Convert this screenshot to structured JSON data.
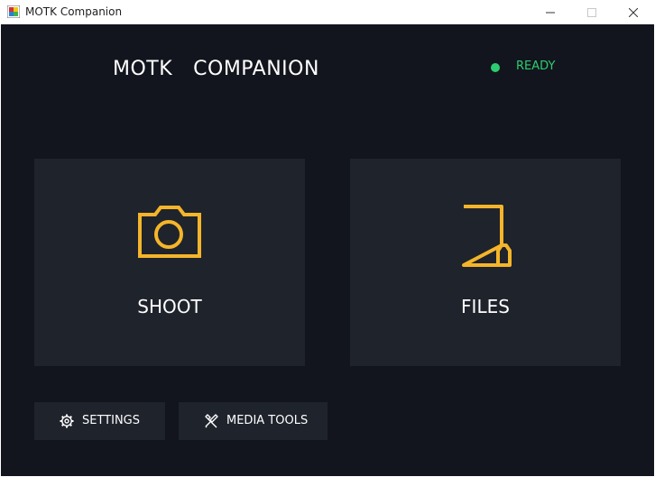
{
  "window": {
    "title": "MOTK Companion"
  },
  "header": {
    "app_title": "MOTK  COMPANION",
    "status_text": "READY",
    "status_color": "#2ecc71"
  },
  "cards": {
    "shoot_label": "SHOOT",
    "shoot_icon": "camera-icon",
    "files_label": "FILES",
    "files_icon": "file-icon"
  },
  "buttons": {
    "settings_label": "SETTINGS",
    "settings_icon": "gear-icon",
    "media_tools_label": "MEDIA TOOLS",
    "media_tools_icon": "tools-icon"
  },
  "colors": {
    "background": "#12151d",
    "card": "#1f232c",
    "accent": "#f5b52a",
    "text": "#ffffff"
  }
}
